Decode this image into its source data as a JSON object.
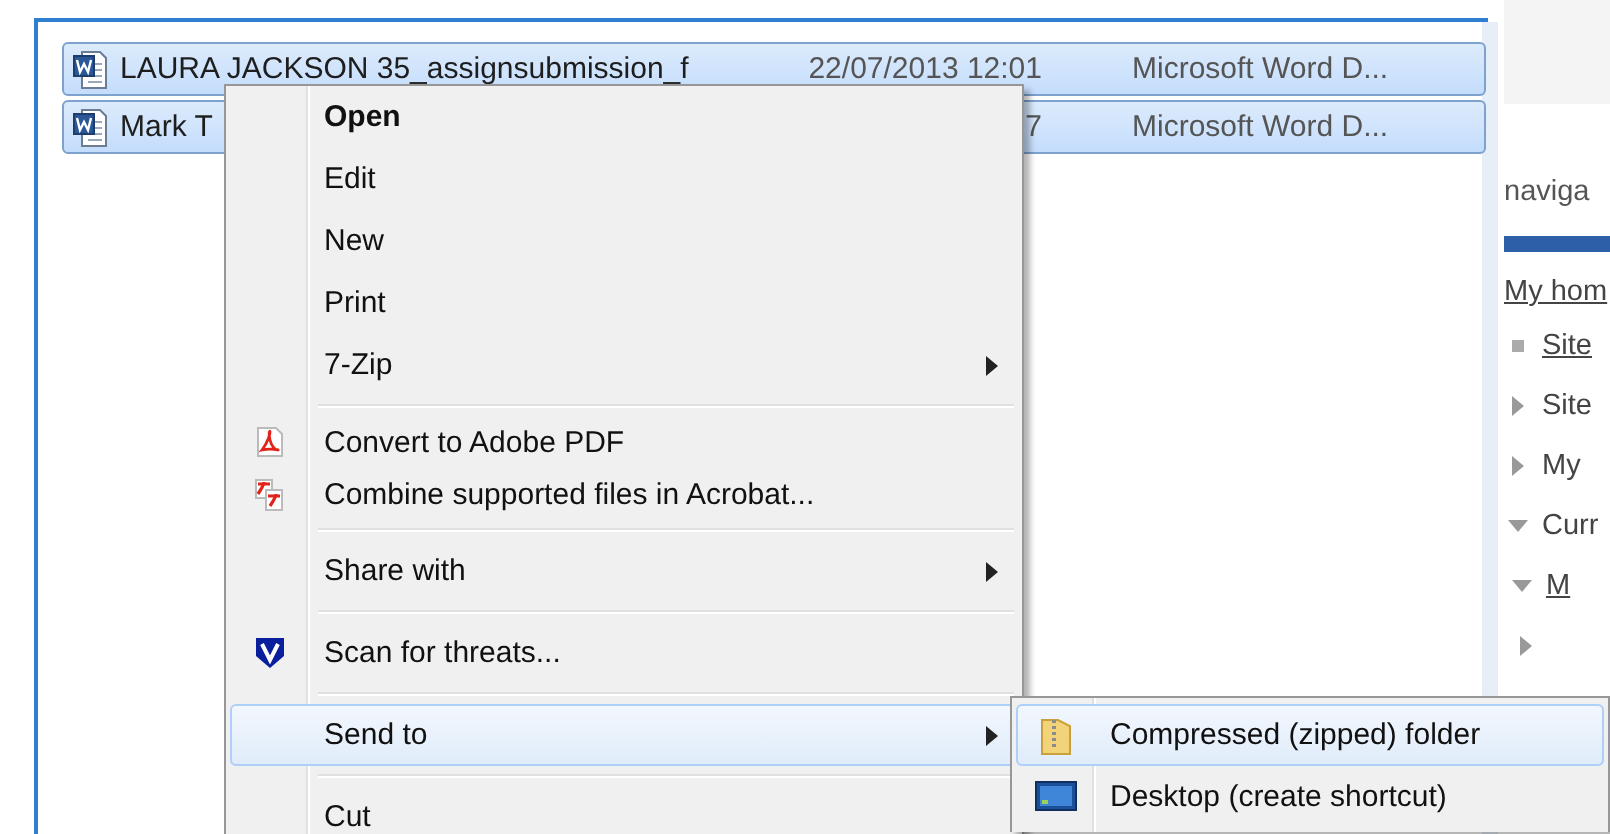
{
  "files": [
    {
      "name": "LAURA JACKSON 35_assignsubmission_f",
      "date": "22/07/2013 12:01",
      "type": "Microsoft Word D...",
      "selected": true
    },
    {
      "name": "Mark T",
      "date": "7",
      "type": "Microsoft Word D...",
      "selected": true
    }
  ],
  "navigation": {
    "heading": "naviga",
    "tree": [
      {
        "label": "My hom",
        "link": true,
        "children": [
          {
            "label": "Site",
            "link": true
          },
          {
            "label": "Site",
            "link": false,
            "expanded": false
          },
          {
            "label": "My",
            "link": false,
            "expanded": false
          },
          {
            "label": "Curr",
            "link": false,
            "expanded": true,
            "children": [
              {
                "label": "M",
                "link": true,
                "expanded": true,
                "children": [
                  {
                    "expanded": false
                  }
                ]
              }
            ]
          }
        ]
      }
    ]
  },
  "context_menu": {
    "items": [
      {
        "kind": "plain",
        "label": "Open",
        "default": true,
        "submenu": false,
        "selected": false
      },
      {
        "kind": "plain",
        "label": "Edit",
        "default": false,
        "submenu": false,
        "selected": false
      },
      {
        "kind": "plain",
        "label": "New",
        "default": false,
        "submenu": false,
        "selected": false
      },
      {
        "kind": "plain",
        "label": "Print",
        "default": false,
        "submenu": false,
        "selected": false
      },
      {
        "kind": "plain",
        "label": "7-Zip",
        "default": false,
        "submenu": true,
        "selected": false
      },
      {
        "kind": "separator"
      },
      {
        "kind": "pdf",
        "label": "Convert to Adobe PDF",
        "default": false,
        "submenu": false,
        "selected": false
      },
      {
        "kind": "combine",
        "label": "Combine supported files in Acrobat...",
        "default": false,
        "submenu": false,
        "selected": false
      },
      {
        "kind": "separator"
      },
      {
        "kind": "plain",
        "label": "Share with",
        "default": false,
        "submenu": true,
        "selected": false
      },
      {
        "kind": "separator"
      },
      {
        "kind": "scan",
        "label": "Scan for threats...",
        "default": false,
        "submenu": false,
        "selected": false
      },
      {
        "kind": "separator"
      },
      {
        "kind": "plain",
        "label": "Send to",
        "default": false,
        "submenu": true,
        "selected": true
      },
      {
        "kind": "separator"
      },
      {
        "kind": "plain",
        "label": "Cut",
        "default": false,
        "submenu": false,
        "selected": false
      }
    ]
  },
  "send_to_menu": {
    "items": [
      {
        "kind": "zip",
        "label": "Compressed (zipped) folder",
        "selected": true
      },
      {
        "kind": "desktop",
        "label": "Desktop (create shortcut)",
        "selected": false
      }
    ]
  }
}
